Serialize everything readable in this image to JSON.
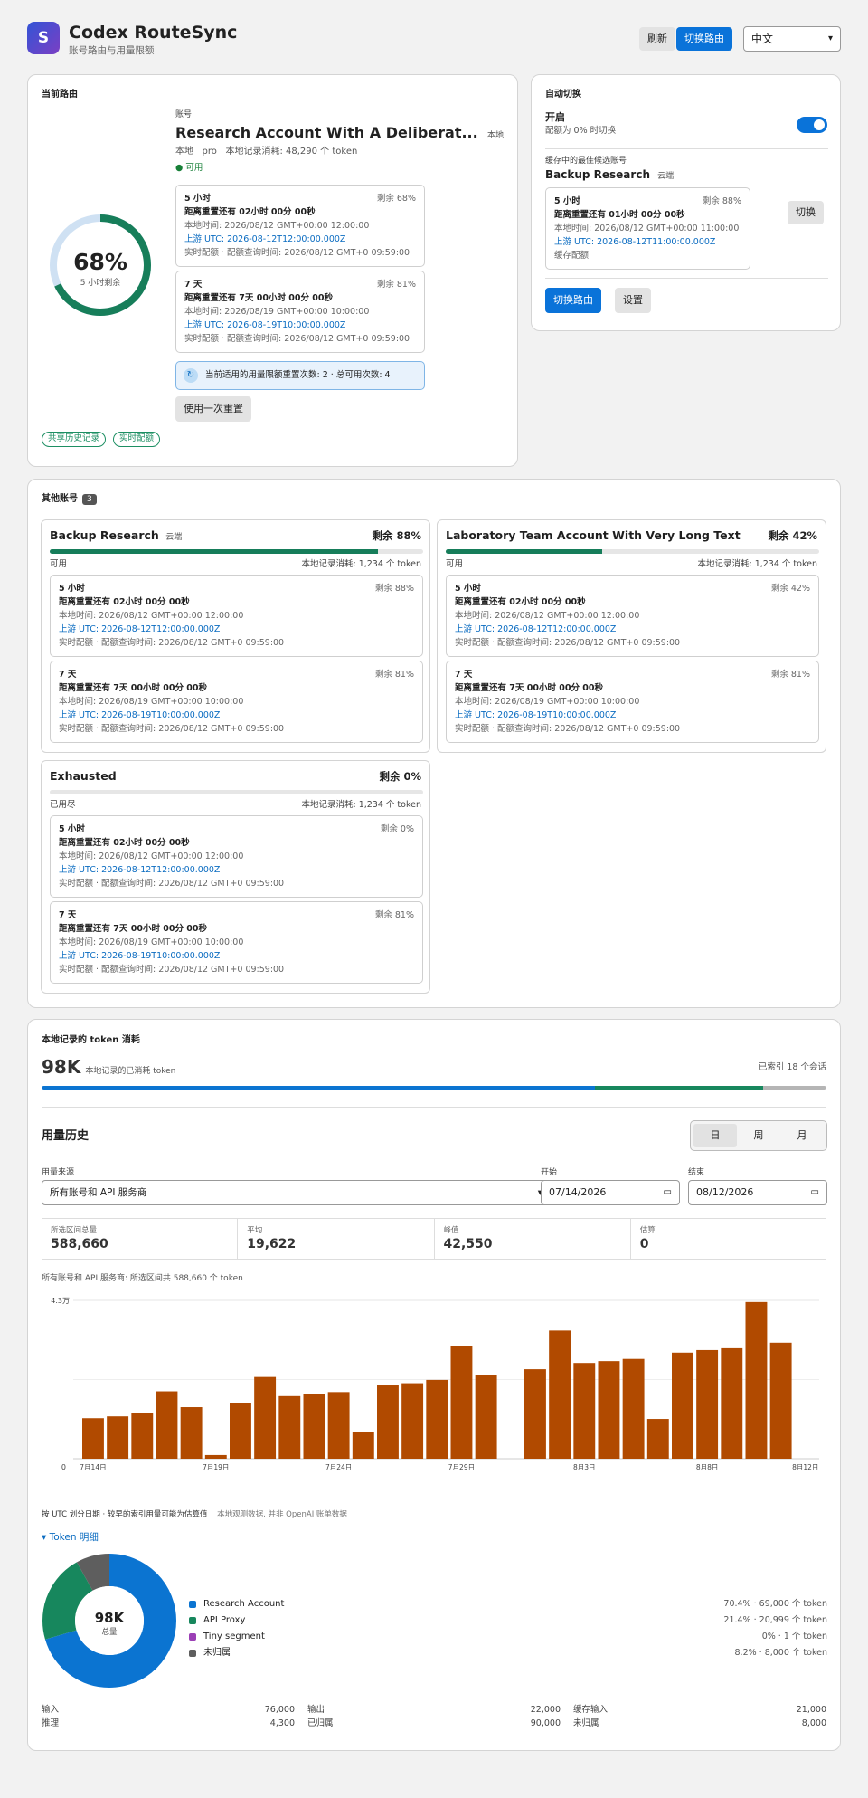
{
  "app": {
    "logo_letter": "S",
    "title": "Codex RouteSync",
    "subtitle": "账号路由与用量限额"
  },
  "header": {
    "refresh_label": "刷新",
    "switch_route_label": "切换路由",
    "language_selected": "中文"
  },
  "current": {
    "section_title": "当前路由",
    "account_label": "账号",
    "account_name": "Research Account With A Deliberat...",
    "location": "本地",
    "meta_local": "本地",
    "meta_plan": "pro",
    "meta_usage": "本地记录消耗: 48,290 个 token",
    "status": "可用",
    "gauge_percent": "68%",
    "gauge_value": 0.68,
    "gauge_caption": "5 小时剩余",
    "windows": [
      {
        "name": "5 小时",
        "remaining": "剩余 68%",
        "reset": "距离重置还有 02小时 00分 00秒",
        "local": "本地时间: 2026/08/12 GMT+00:00 12:00:00",
        "upstream": "上游 UTC: 2026-08-12T12:00:00.000Z",
        "query": "实时配额 · 配额查询时间: 2026/08/12 GMT+0 09:59:00"
      },
      {
        "name": "7 天",
        "remaining": "剩余 81%",
        "reset": "距离重置还有 7天 00小时 00分 00秒",
        "local": "本地时间: 2026/08/19 GMT+00:00 10:00:00",
        "upstream": "上游 UTC: 2026-08-19T10:00:00.000Z",
        "query": "实时配额 · 配额查询时间: 2026/08/12 GMT+0 09:59:00"
      }
    ],
    "reset_notice": "当前适用的用量限额重置次数: 2 · 总可用次数: 4",
    "use_reset_label": "使用一次重置",
    "chips": [
      "共享历史记录",
      "实时配额"
    ]
  },
  "auto": {
    "section_title": "自动切换",
    "status_title": "开启",
    "status_desc": "配额为 0% 时切换",
    "toggle_on": true,
    "best_label": "缓存中的最佳候选账号",
    "best_name": "Backup Research",
    "best_loc": "云端",
    "window": {
      "name": "5 小时",
      "remaining": "剩余 88%",
      "reset": "距离重置还有 01小时 00分 00秒",
      "local": "本地时间: 2026/08/12 GMT+00:00 11:00:00",
      "upstream": "上游 UTC: 2026-08-12T11:00:00.000Z",
      "query": "缓存配额"
    },
    "switch_label": "切换",
    "switch_route_label": "切换路由",
    "settings_label": "设置"
  },
  "others": {
    "section_title": "其他账号",
    "count": "3",
    "accounts": [
      {
        "name": "Backup Research",
        "loc": "云端",
        "remaining": "剩余 88%",
        "progress": 0.88,
        "status": "可用",
        "usage": "本地记录消耗: 1,234 个 token",
        "windows": [
          {
            "name": "5 小时",
            "remaining": "剩余 88%",
            "reset": "距离重置还有 02小时 00分 00秒",
            "local": "本地时间: 2026/08/12 GMT+00:00 12:00:00",
            "upstream": "上游 UTC: 2026-08-12T12:00:00.000Z",
            "query": "实时配额 · 配额查询时间: 2026/08/12 GMT+0 09:59:00"
          },
          {
            "name": "7 天",
            "remaining": "剩余 81%",
            "reset": "距离重置还有 7天 00小时 00分 00秒",
            "local": "本地时间: 2026/08/19 GMT+00:00 10:00:00",
            "upstream": "上游 UTC: 2026-08-19T10:00:00.000Z",
            "query": "实时配额 · 配额查询时间: 2026/08/12 GMT+0 09:59:00"
          }
        ]
      },
      {
        "name": "Laboratory Team Account With Very Long Text",
        "loc": "",
        "remaining": "剩余 42%",
        "progress": 0.42,
        "status": "可用",
        "usage": "本地记录消耗: 1,234 个 token",
        "windows": [
          {
            "name": "5 小时",
            "remaining": "剩余 42%",
            "reset": "距离重置还有 02小时 00分 00秒",
            "local": "本地时间: 2026/08/12 GMT+00:00 12:00:00",
            "upstream": "上游 UTC: 2026-08-12T12:00:00.000Z",
            "query": "实时配额 · 配额查询时间: 2026/08/12 GMT+0 09:59:00"
          },
          {
            "name": "7 天",
            "remaining": "剩余 81%",
            "reset": "距离重置还有 7天 00小时 00分 00秒",
            "local": "本地时间: 2026/08/19 GMT+00:00 10:00:00",
            "upstream": "上游 UTC: 2026-08-19T10:00:00.000Z",
            "query": "实时配额 · 配额查询时间: 2026/08/12 GMT+0 09:59:00"
          }
        ]
      },
      {
        "name": "Exhausted",
        "loc": "",
        "remaining": "剩余 0%",
        "progress": 0,
        "status": "已用尽",
        "usage": "本地记录消耗: 1,234 个 token",
        "windows": [
          {
            "name": "5 小时",
            "remaining": "剩余 0%",
            "reset": "距离重置还有 02小时 00分 00秒",
            "local": "本地时间: 2026/08/12 GMT+00:00 12:00:00",
            "upstream": "上游 UTC: 2026-08-12T12:00:00.000Z",
            "query": "实时配额 · 配额查询时间: 2026/08/12 GMT+0 09:59:00"
          },
          {
            "name": "7 天",
            "remaining": "剩余 81%",
            "reset": "距离重置还有 7天 00小时 00分 00秒",
            "local": "本地时间: 2026/08/19 GMT+00:00 10:00:00",
            "upstream": "上游 UTC: 2026-08-19T10:00:00.000Z",
            "query": "实时配额 · 配额查询时间: 2026/08/12 GMT+0 09:59:00"
          }
        ]
      }
    ]
  },
  "usage": {
    "section_title": "本地记录的 token 消耗",
    "total_big": "98K",
    "total_desc": "本地记录的已消耗 token",
    "indexed": "已索引 18 个会话",
    "mix": [
      0.705,
      0.214,
      0.081
    ],
    "history_title": "用量历史",
    "periods": [
      "日",
      "周",
      "月"
    ],
    "active_period": "日",
    "source_label": "用量来源",
    "source_value": "所有账号和 API 服务商",
    "start_label": "开始",
    "start_value": "07/14/2026",
    "end_label": "结束",
    "end_value": "08/12/2026",
    "stats": [
      {
        "label": "所选区间总量",
        "value": "588,660"
      },
      {
        "label": "平均",
        "value": "19,622"
      },
      {
        "label": "峰值",
        "value": "42,550"
      },
      {
        "label": "估算",
        "value": "0"
      }
    ],
    "summary": "所有账号和 API 服务商: 所选区间共 588,660 个 token",
    "footnote_a": "按 UTC 划分日期 · 较早的索引用量可能为估算值",
    "footnote_b": "本地观测数据, 并非 OpenAI 账单数据",
    "breakdown_title": "▾ Token 明细",
    "donut_total": "98K",
    "donut_caption": "总量",
    "legend": [
      {
        "name": "Research Account",
        "value": "70.4% · 69,000 个 token",
        "color": "#0b74d1"
      },
      {
        "name": "API Proxy",
        "value": "21.4% · 20,999 个 token",
        "color": "#17875d"
      },
      {
        "name": "Tiny segment",
        "value": "0% · 1 个 token",
        "color": "#9b3fb5"
      },
      {
        "name": "未归属",
        "value": "8.2% · 8,000 个 token",
        "color": "#5e5e5e"
      }
    ],
    "totals": [
      [
        {
          "k": "输入",
          "v": "76,000"
        },
        {
          "k": "推理",
          "v": "4,300"
        }
      ],
      [
        {
          "k": "输出",
          "v": "22,000"
        },
        {
          "k": "已归属",
          "v": "90,000"
        }
      ],
      [
        {
          "k": "缓存输入",
          "v": "21,000"
        },
        {
          "k": "未归属",
          "v": "8,000"
        }
      ]
    ]
  },
  "chart_data": {
    "type": "bar",
    "title": "",
    "xlabel": "",
    "ylabel": "",
    "ylim": [
      0,
      43000
    ],
    "ytick_labels": [
      "0",
      "4.3万"
    ],
    "categories": [
      "7/14",
      "7/15",
      "7/16",
      "7/17",
      "7/18",
      "7/19",
      "7/20",
      "7/21",
      "7/22",
      "7/23",
      "7/24",
      "7/25",
      "7/26",
      "7/27",
      "7/28",
      "7/29",
      "7/30",
      "7/31",
      "8/1",
      "8/2",
      "8/3",
      "8/4",
      "8/5",
      "8/6",
      "8/7",
      "8/8",
      "8/9",
      "8/10",
      "8/11",
      "8/12"
    ],
    "xtick_labels": [
      "7月14日",
      "7月19日",
      "7月24日",
      "7月29日",
      "8月3日",
      "8月8日",
      "8月12日"
    ],
    "xtick_index": [
      0,
      5,
      10,
      15,
      20,
      25,
      29
    ],
    "values": [
      11000,
      11500,
      12500,
      18300,
      14000,
      1000,
      15200,
      22200,
      17000,
      17600,
      18100,
      7300,
      19900,
      20500,
      21400,
      30700,
      22700,
      0,
      24300,
      34800,
      26000,
      26500,
      27100,
      10800,
      28800,
      29500,
      30000,
      42550,
      31500,
      0
    ],
    "color": "#b14a00"
  }
}
